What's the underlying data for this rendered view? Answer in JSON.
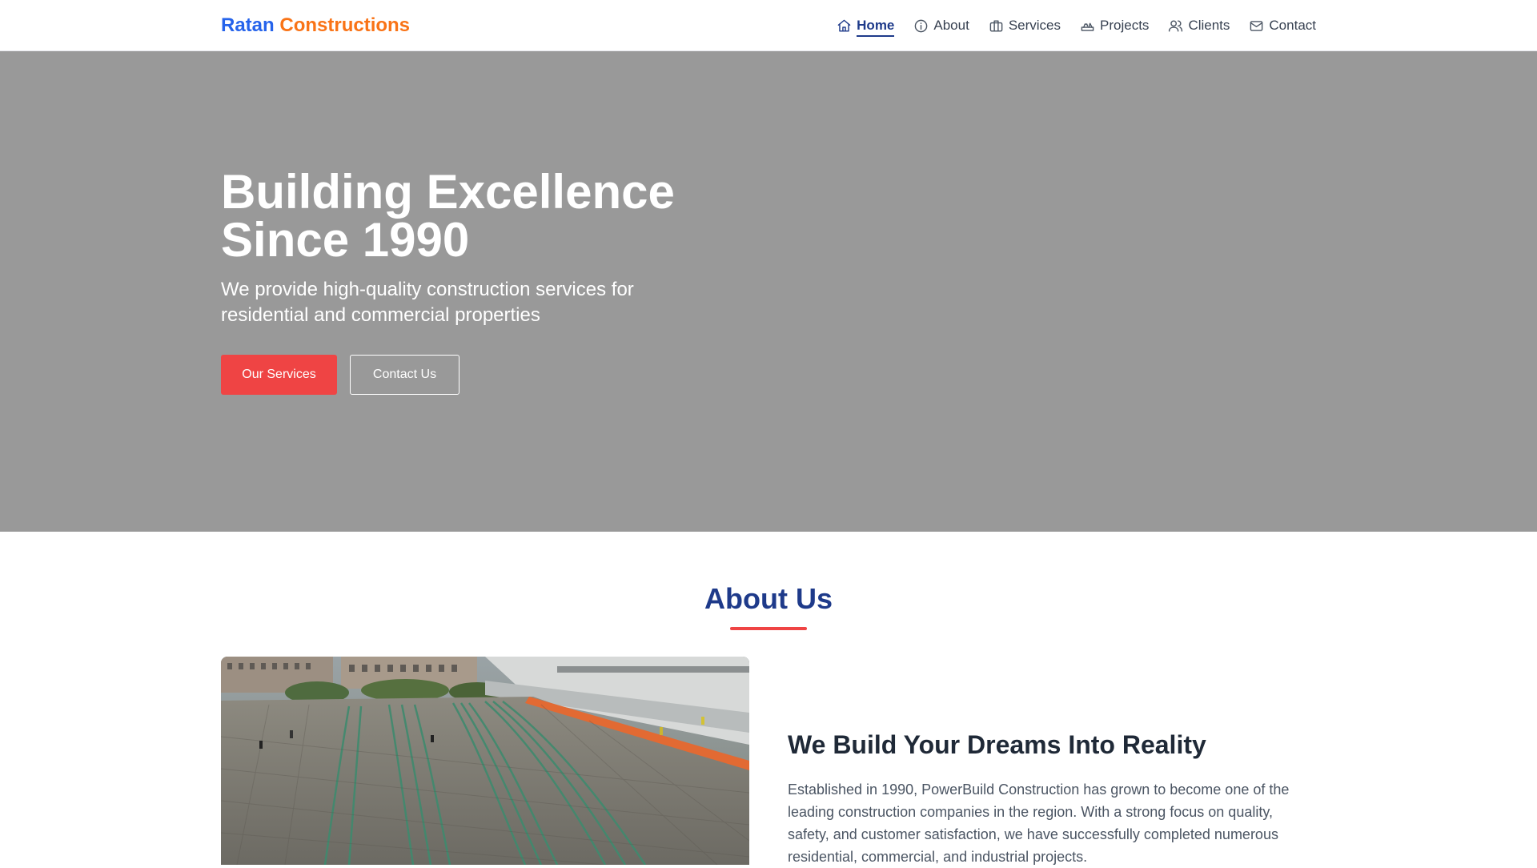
{
  "header": {
    "logo_part1": "Ratan",
    "logo_part2": "Constructions",
    "nav": [
      {
        "label": "Home",
        "icon": "home-icon",
        "active": true
      },
      {
        "label": "About",
        "icon": "info-icon"
      },
      {
        "label": "Services",
        "icon": "briefcase-icon"
      },
      {
        "label": "Projects",
        "icon": "projects-icon"
      },
      {
        "label": "Clients",
        "icon": "users-icon"
      },
      {
        "label": "Contact",
        "icon": "mail-icon"
      }
    ]
  },
  "hero": {
    "title": "Building Excellence Since 1990",
    "subtitle": "We provide high-quality construction services for residential and commercial properties",
    "primary_button": "Our Services",
    "secondary_button": "Contact Us"
  },
  "about": {
    "title": "About Us",
    "heading": "We Build Your Dreams Into Reality",
    "text": "Established in 1990, PowerBuild Construction has grown to become one of the leading construction companies in the region. With a strong focus on quality, safety, and customer satisfaction, we have successfully completed numerous residential, commercial, and industrial projects.",
    "image_icon": "construction-site-photo"
  },
  "colors": {
    "brand_blue": "#2563eb",
    "brand_orange": "#f97316",
    "accent_red": "#ef4444",
    "navy": "#1e3a8a",
    "hero_bg": "#999999"
  }
}
